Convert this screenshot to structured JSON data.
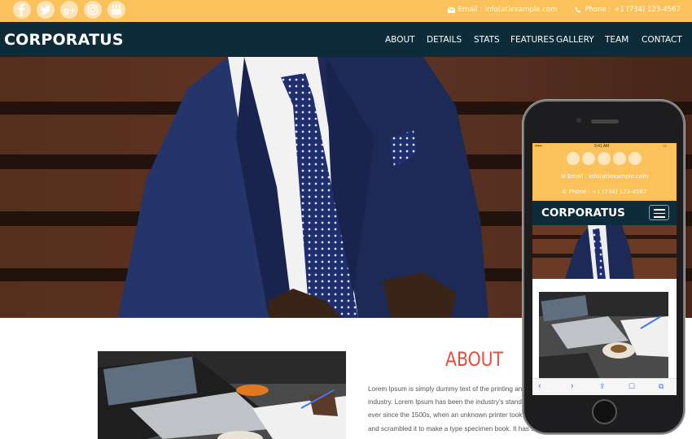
{
  "topbar": {
    "social": [
      "facebook-icon",
      "twitter-icon",
      "google-plus-icon",
      "instagram-icon",
      "youtube-icon"
    ],
    "email_label": "Email :",
    "email": "info(at)example.com",
    "phone_label": "Phone :",
    "phone": "+1 (734) 123-4567"
  },
  "nav": {
    "brand": "CORPORATUS",
    "items": [
      "ABOUT",
      "DETAILS",
      "STATS",
      "FEATURES",
      "GALLERY",
      "TEAM",
      "CONTACT"
    ]
  },
  "about": {
    "title": "ABOUT",
    "lines": [
      "Lorem Ipsum is simply dummy text of the printing and",
      "industry. Lorem Ipsum has been the industry's standard",
      "ever since the 1500s, when an unknown printer took a",
      "and scrambled it to make a type specimen book. It has su"
    ]
  },
  "mobile": {
    "time": "9:41 AM",
    "carrier": "•••••",
    "brand": "CORPORATUS",
    "email_label": "Email :",
    "email": "info(at)example.com",
    "phone_label": "Phone :",
    "phone": "+1 (734) 123-4567",
    "toolbar": [
      "back-icon",
      "forward-icon",
      "share-icon",
      "bookmarks-icon",
      "tabs-icon"
    ]
  },
  "colors": {
    "topbar": "#fbc25c",
    "navbar": "#0d2b39",
    "accent": "#e84c3d"
  }
}
